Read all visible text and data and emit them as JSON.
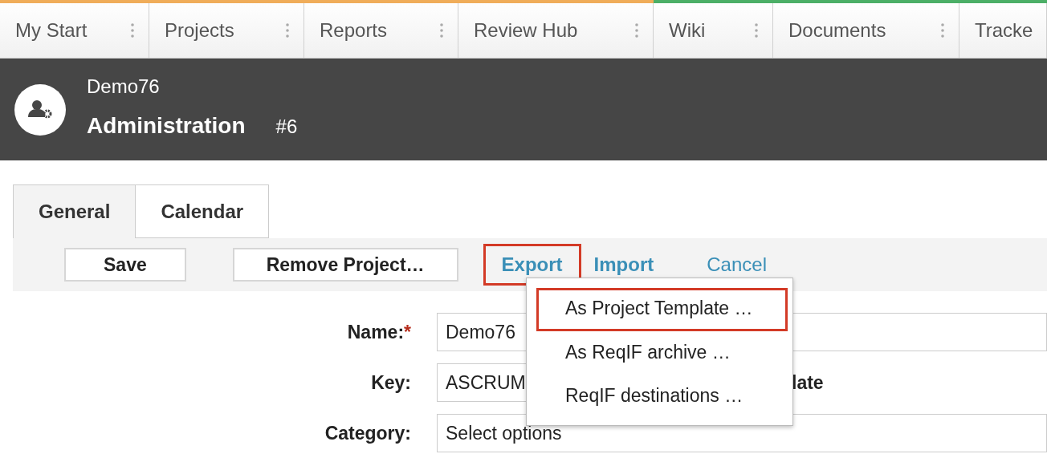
{
  "nav_tabs": [
    {
      "label": "My Start",
      "color": "#f0ad5a"
    },
    {
      "label": "Projects",
      "color": "#f0ad5a"
    },
    {
      "label": "Reports",
      "color": "#f0ad5a"
    },
    {
      "label": "Review Hub",
      "color": "#f0ad5a"
    },
    {
      "label": "Wiki",
      "color": "#4caf67"
    },
    {
      "label": "Documents",
      "color": "#4caf67"
    },
    {
      "label": "Tracke",
      "color": "#4caf67"
    }
  ],
  "header": {
    "project": "Demo76",
    "title": "Administration",
    "number": "#6"
  },
  "tabs": [
    {
      "label": "General",
      "selected": true
    },
    {
      "label": "Calendar",
      "selected": false
    }
  ],
  "toolbar": [
    {
      "kind": "button",
      "label": "Save"
    },
    {
      "kind": "button",
      "label": "Remove Project…"
    },
    {
      "kind": "menu-link",
      "label": "Export",
      "highlighted": true
    },
    {
      "kind": "link",
      "label": "Import"
    },
    {
      "kind": "plain-link",
      "label": "Cancel"
    }
  ],
  "export_menu": [
    {
      "label": "As Project Template …",
      "highlighted": true
    },
    {
      "label": "As ReqIF archive …",
      "highlighted": false
    },
    {
      "label": "ReqIF destinations …",
      "highlighted": false
    }
  ],
  "form": [
    {
      "label": "Name:",
      "required_mark": "*",
      "value": "Demo76"
    },
    {
      "label": "Key:",
      "value": "ASCRUM",
      "trailing": "late"
    },
    {
      "label": "Category:",
      "value": "Select options"
    }
  ]
}
